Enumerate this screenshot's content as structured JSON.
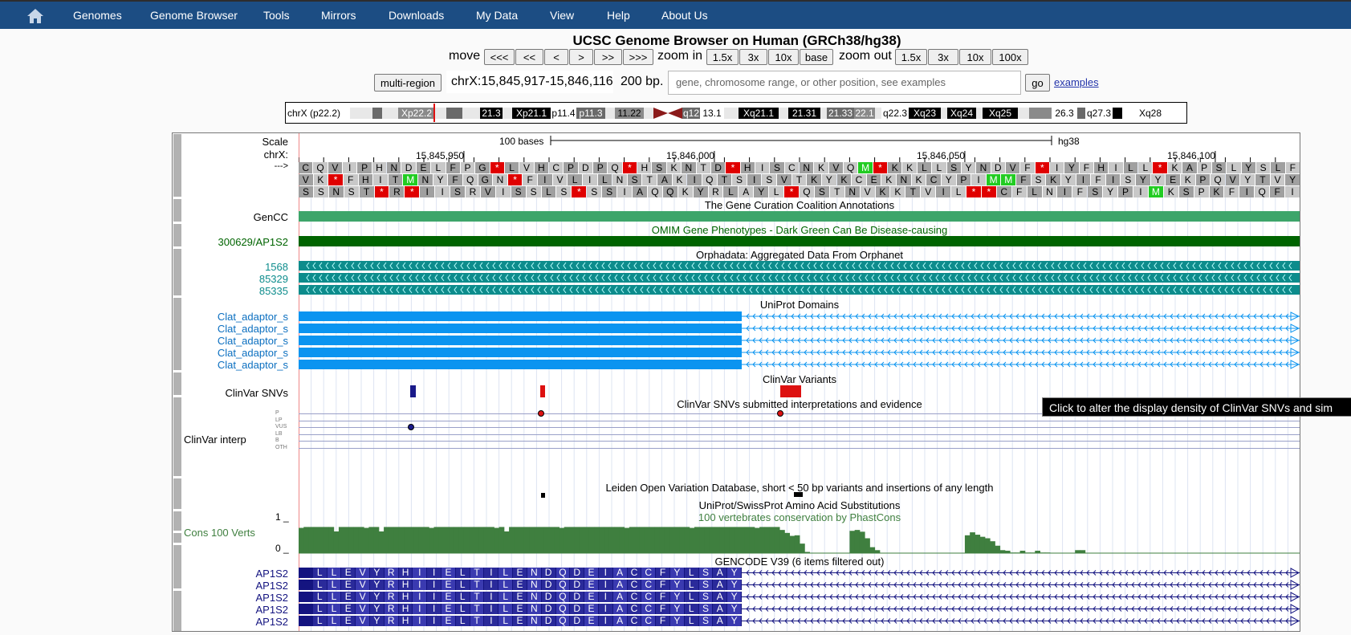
{
  "nav": {
    "items": [
      "Genomes",
      "Genome Browser",
      "Tools",
      "Mirrors",
      "Downloads",
      "My Data",
      "View",
      "Help",
      "About Us"
    ]
  },
  "title": "UCSC Genome Browser on Human (GRCh38/hg38)",
  "move": {
    "label": "move",
    "buttons": [
      "<<<",
      "<<",
      "<",
      ">",
      ">>",
      ">>>"
    ],
    "zoom_in_label": "zoom in",
    "zoom_in_buttons": [
      "1.5x",
      "3x",
      "10x",
      "base"
    ],
    "zoom_out_label": "zoom out",
    "zoom_out_buttons": [
      "1.5x",
      "3x",
      "10x",
      "100x"
    ]
  },
  "position": {
    "multi_region_label": "multi-region",
    "position_text": "chrX:15,845,917-15,846,116",
    "size_text": "200 bp.",
    "search_placeholder": "gene, chromosome range, or other position, see examples",
    "go_label": "go",
    "examples_label": "examples"
  },
  "ideogram": {
    "chrom_label": "chrX (p22.2)",
    "bands": [
      "Xp22.2",
      "21.3",
      "Xp21.1",
      "p11.4",
      "p11.3",
      "11.22",
      "q12",
      "13.1",
      "Xq21.1",
      "21.31",
      "21.33",
      "22.1",
      "q22.3",
      "Xq23",
      "Xq24",
      "Xq25",
      "26.3",
      "q27.3",
      "Xq28"
    ]
  },
  "ruler": {
    "scale_label": "Scale",
    "chrom_label": "chrX:",
    "strand_label": "--->",
    "bases_label": "100 bases",
    "assembly_label": "hg38",
    "ticks": [
      "15,845,950",
      "15,846,000",
      "15,846,050",
      "15,846,100"
    ]
  },
  "translation": {
    "frame1": "CQVIPHNDELFPG*LVHCPDPQ*HSKNTD*HISCNKVQM*KKLLSYNDVF*IYFHILL*KAPSLYSLF",
    "frame2": "VK*FHITMNYFQGN*FIVLILNSTAKIQTSISVTKYKCEKNKCYPIMMFSKYIFISYYEKPQVYTVY",
    "frame3": "SSNST*R*IISRVISSLS*SSIAQQKYRLAYL*QSTNVKKTVIL**CFLNIFSYPIMKSPKFIQFI"
  },
  "tracks": {
    "gencc_title": "The Gene Curation Coalition Annotations",
    "gencc_label": "GenCC",
    "omim_title": "OMIM Gene Phenotypes - Dark Green Can Be Disease-causing",
    "omim_label": "300629/AP1S2",
    "orpha_title": "Orphadata: Aggregated Data From Orphanet",
    "orpha_labels": [
      "1568",
      "85329",
      "85335"
    ],
    "uniprot_title": "UniProt Domains",
    "uniprot_labels": [
      "Clat_adaptor_s",
      "Clat_adaptor_s",
      "Clat_adaptor_s",
      "Clat_adaptor_s",
      "Clat_adaptor_s"
    ],
    "clinvar_title": "ClinVar Variants",
    "clinvar_label": "ClinVar SNVs",
    "clinvar_interp_title": "ClinVar SNVs submitted interpretations and evidence",
    "clinvar_interp_label": "ClinVar interp",
    "clinvar_interp_rows": [
      "P",
      "LP",
      "VUS",
      "LB",
      "B",
      "OTH"
    ],
    "lovd_title": "Leiden Open Variation Database, short < 50 bp variants and insertions of any length",
    "uniprot_sub_title": "UniProt/SwissProt Amino Acid Substitutions",
    "cons_title": "100 vertebrates conservation by PhastCons",
    "cons_label": "Cons 100 Verts",
    "cons_max": "1 _",
    "cons_min": "0 _",
    "gencode_title": "GENCODE V39 (6 items filtered out)",
    "gencode_labels": [
      "AP1S2",
      "AP1S2",
      "AP1S2",
      "AP1S2",
      "AP1S2"
    ],
    "gencode_aa": "LLEVYRHIIELTILENDQDEIACCFYLSAY"
  },
  "tooltip": "Click to alter the display density of ClinVar SNVs and sim",
  "colors": {
    "topbar": "#1c4d83",
    "gencc": "#3da56a",
    "omim": "#006400",
    "orpha": "#0d8c8c",
    "uniprot": "#0b94f0",
    "cons": "#3f7f3f",
    "gencode": "#141480"
  }
}
